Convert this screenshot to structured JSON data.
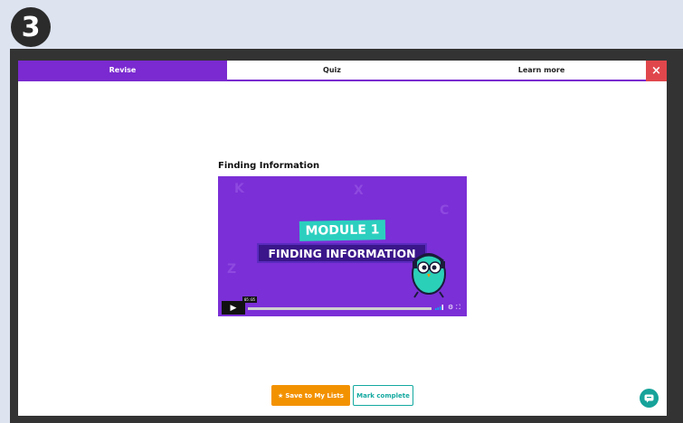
{
  "step_badge": "3",
  "tabs": [
    {
      "label": "Revise",
      "active": true
    },
    {
      "label": "Quiz",
      "active": false
    },
    {
      "label": "Learn more",
      "active": false
    }
  ],
  "close_label": "×",
  "content": {
    "title": "Finding Information",
    "video": {
      "module_label": "MODULE 1",
      "module_title": "FINDING INFORMATION",
      "time": "05:05",
      "progress": 0
    }
  },
  "actions": {
    "save_label": "Save to My Lists",
    "mark_label": "Mark complete"
  },
  "colors": {
    "accent": "#7a2ad0",
    "close": "#e0474c",
    "save": "#f39200",
    "teal": "#14a9a0"
  }
}
